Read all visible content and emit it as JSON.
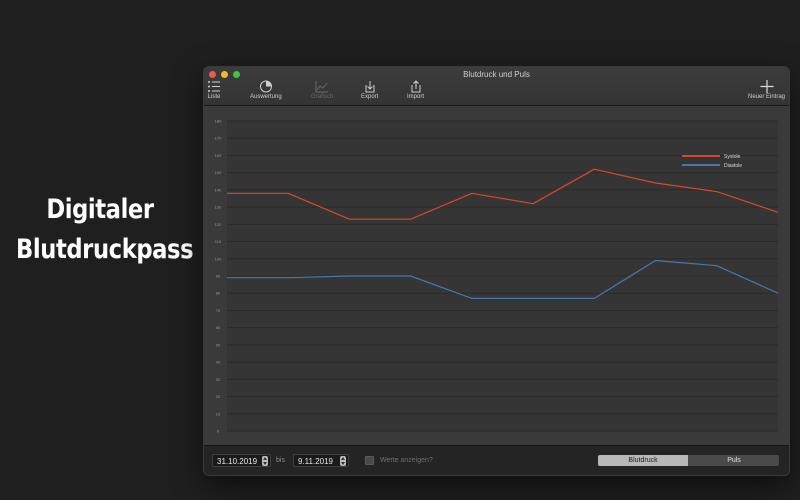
{
  "promo": {
    "line1": "Digitaler",
    "line2": "Blutdruckpass"
  },
  "window": {
    "title": "Blutdruck und Puls"
  },
  "toolbar": {
    "liste": "Liste",
    "auswertung": "Auswertung",
    "grafisch": "Grafisch",
    "export": "Export",
    "import": "Import",
    "neuer_eintrag": "Neuer Eintrag"
  },
  "filter": {
    "from_date": "31.10.2019",
    "bis_label": "bis",
    "to_date": "9.11.2019",
    "show_values_label": "Werte anzeigen?",
    "show_values_checked": false
  },
  "segment": {
    "options": [
      "Blutdruck",
      "Puls"
    ],
    "selected": "Blutdruck"
  },
  "chart_data": {
    "type": "line",
    "ylim": [
      0,
      180
    ],
    "yticks": [
      0,
      10,
      20,
      30,
      40,
      50,
      60,
      70,
      80,
      90,
      100,
      110,
      120,
      130,
      140,
      150,
      160,
      170,
      180
    ],
    "series": [
      {
        "name": "Systole",
        "color": "#d9472b",
        "values": [
          138,
          138,
          123,
          123,
          138,
          132,
          152,
          144,
          139,
          127
        ]
      },
      {
        "name": "Diastole",
        "color": "#4a77a8",
        "values": [
          89,
          89,
          90,
          90,
          77,
          77,
          77,
          99,
          96,
          80
        ]
      }
    ],
    "legend_position": "top-right",
    "grid": true
  }
}
